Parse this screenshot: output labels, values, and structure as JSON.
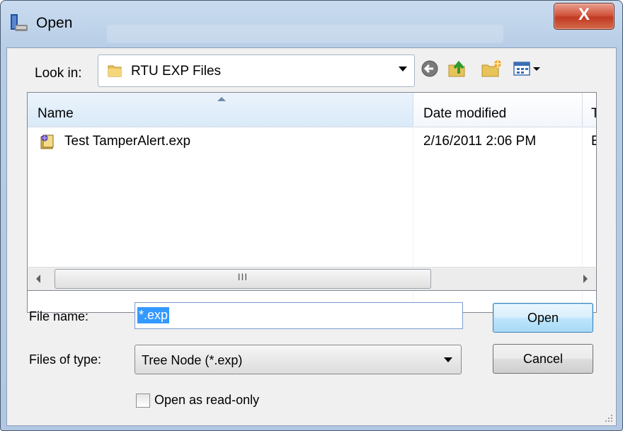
{
  "window": {
    "title": "Open",
    "close_symbol": "X"
  },
  "look_in": {
    "label": "Look in:",
    "value": "RTU EXP Files"
  },
  "toolbar": {
    "icons": [
      "back-icon",
      "up-folder-icon",
      "new-folder-icon",
      "view-menu-icon"
    ]
  },
  "file_list": {
    "columns": [
      "Name",
      "Date modified",
      "Ty"
    ],
    "rows": [
      {
        "name": "Test TamperAlert.exp",
        "date": "2/16/2011 2:06 PM",
        "type": "Ex"
      }
    ]
  },
  "scrollbar": {
    "thumb_grip": "III"
  },
  "file_name": {
    "label": "File name:",
    "value": "*.exp"
  },
  "file_type": {
    "label": "Files of type:",
    "value": "Tree Node (*.exp)"
  },
  "buttons": {
    "open": "Open",
    "cancel": "Cancel"
  },
  "read_only": {
    "label": "Open as read-only",
    "checked": false
  },
  "colors": {
    "title_bar": "#c9dbef",
    "close_button": "#c13a22",
    "selection": "#3399ff",
    "default_button": "#bee6fd"
  }
}
